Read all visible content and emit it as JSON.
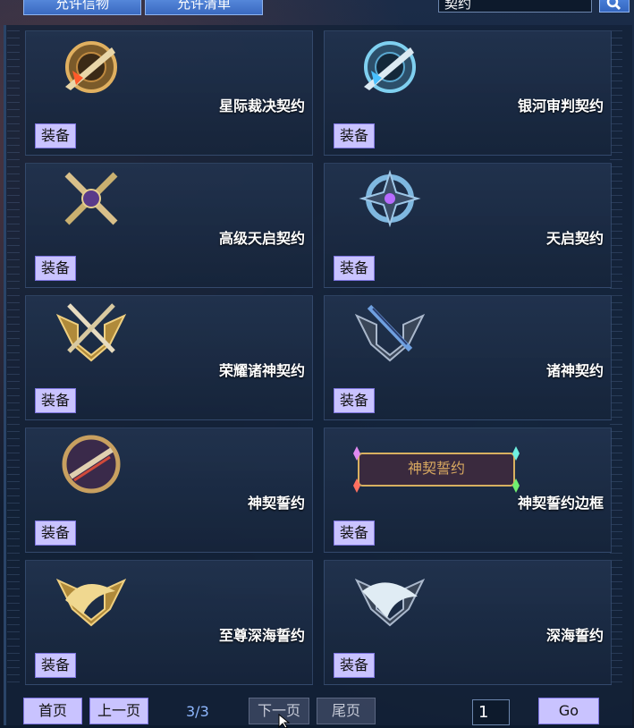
{
  "header": {
    "tabs": [
      "允许信物",
      "允许清单"
    ],
    "search_value": "契约"
  },
  "items": [
    {
      "name": "星际裁决契约",
      "equip": "装备",
      "icon": "gear-wing-icon"
    },
    {
      "name": "银河审判契约",
      "equip": "装备",
      "icon": "blue-gear-wing-icon"
    },
    {
      "name": "高级天启契约",
      "equip": "装备",
      "icon": "crossed-swords-icon"
    },
    {
      "name": "天启契约",
      "equip": "装备",
      "icon": "blue-star-icon"
    },
    {
      "name": "荣耀诸神契约",
      "equip": "装备",
      "icon": "gold-shield-swords-icon"
    },
    {
      "name": "诸神契约",
      "equip": "装备",
      "icon": "dark-shield-sword-icon"
    },
    {
      "name": "神契誓约",
      "equip": "装备",
      "icon": "ring-emblem-icon"
    },
    {
      "name": "神契誓约边框",
      "equip": "装备",
      "icon": "nameplate-frame-icon",
      "frame_text": "神契誓约"
    },
    {
      "name": "至尊深海誓约",
      "equip": "装备",
      "icon": "gold-shark-shield-icon"
    },
    {
      "name": "深海誓约",
      "equip": "装备",
      "icon": "silver-shark-shield-icon"
    }
  ],
  "pagination": {
    "first": "首页",
    "prev": "上一页",
    "page_info": "3/3",
    "next": "下一页",
    "last": "尾页",
    "page_input": "1",
    "go": "Go"
  }
}
